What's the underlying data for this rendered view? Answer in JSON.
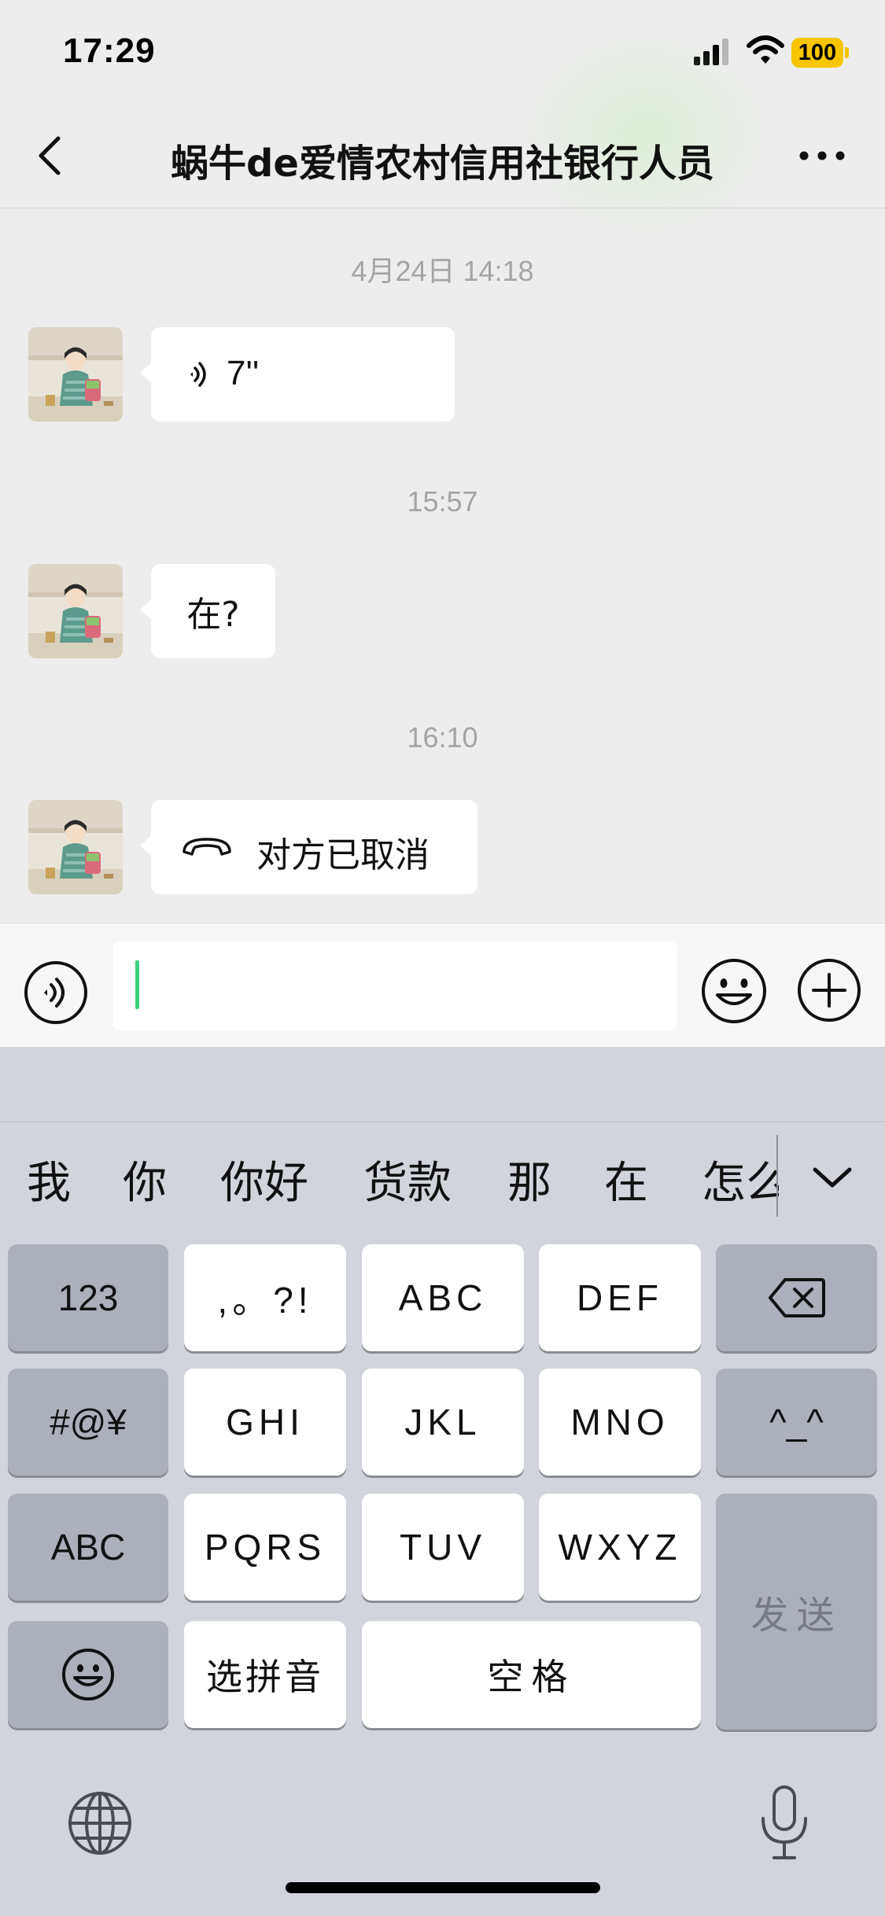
{
  "status_bar": {
    "time": "17:29",
    "battery": "100"
  },
  "nav": {
    "title": "蜗牛de爱情农村信用社银行人员",
    "back_icon": "chevron-left-icon",
    "more_icon": "ellipsis-icon"
  },
  "messages": [
    {
      "timestamp": "4月24日 14:18",
      "type": "voice",
      "duration": "7''"
    },
    {
      "timestamp": "15:57",
      "type": "text",
      "text": "在?"
    },
    {
      "timestamp": "16:10",
      "type": "call",
      "text": "对方已取消"
    }
  ],
  "input_bar": {
    "value": "",
    "voice_icon": "voice-icon",
    "emoji_icon": "emoji-icon",
    "plus_icon": "plus-icon"
  },
  "keyboard": {
    "candidates": [
      "我",
      "你",
      "你好",
      "货款",
      "那",
      "在",
      "怎么"
    ],
    "keys": {
      "num": "123",
      "punct": ",。?!",
      "abc": "ABC",
      "def": "DEF",
      "sym": "#@¥",
      "ghi": "GHI",
      "jkl": "JKL",
      "mno": "MNO",
      "kaomoji": "^_^",
      "abc_switch": "ABC",
      "pqrs": "PQRS",
      "tuv": "TUV",
      "wxyz": "WXYZ",
      "send": "发送",
      "pinyin": "选拼音",
      "space": "空格"
    },
    "colors": {
      "letter_key": "#ffffff",
      "function_key": "#abb0bb",
      "background": "#d1d4db",
      "caret": "#3cd07b"
    }
  }
}
